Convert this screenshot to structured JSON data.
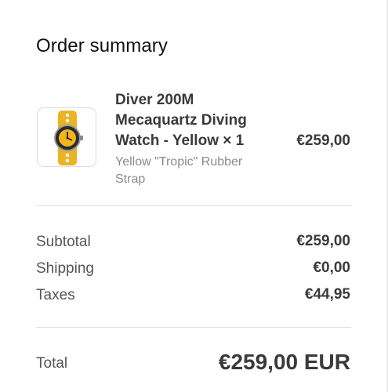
{
  "summary": {
    "title": "Order summary"
  },
  "item": {
    "name_line1": "Diver 200M",
    "name_line2": "Mecaquartz Diving",
    "name_line3": "Watch - Yellow × 1",
    "variant_line1": "Yellow \"Tropic\" Rubber",
    "variant_line2": "Strap",
    "price": "€259,00",
    "image_icon": "yellow-watch-image"
  },
  "totals": {
    "subtotal_label": "Subtotal",
    "subtotal_value": "€259,00",
    "shipping_label": "Shipping",
    "shipping_value": "€0,00",
    "taxes_label": "Taxes",
    "taxes_value": "€44,95",
    "total_label": "Total",
    "total_value": "€259,00 EUR"
  },
  "colors": {
    "strap_yellow": "#e9b526",
    "dial_yellow": "#f2b51a",
    "text_dark": "#3a3a3a",
    "text_muted": "#8a8a8a",
    "divider": "#dedede"
  }
}
